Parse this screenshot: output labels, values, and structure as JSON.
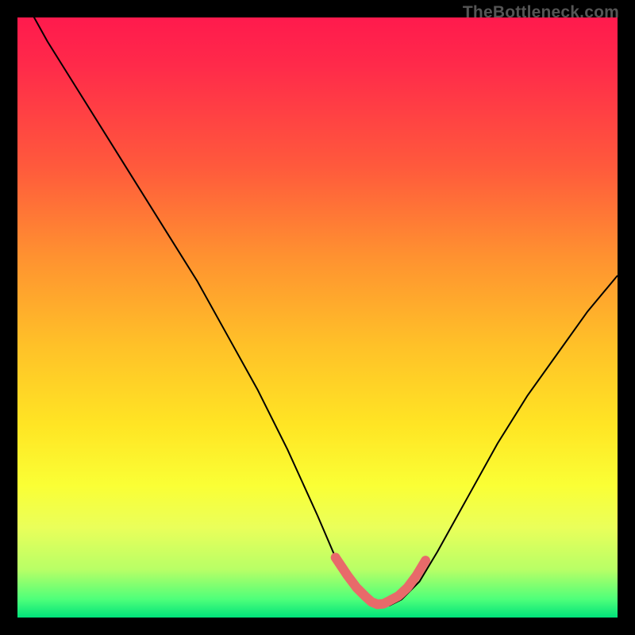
{
  "watermark": "TheBottleneck.com",
  "chart_data": {
    "type": "line",
    "title": "",
    "xlabel": "",
    "ylabel": "",
    "x_range": [
      0,
      100
    ],
    "y_range": [
      0,
      100
    ],
    "series": [
      {
        "name": "bottleneck-curve",
        "color": "#000000",
        "x": [
          0,
          5,
          10,
          15,
          20,
          25,
          30,
          35,
          40,
          45,
          50,
          53,
          56,
          58,
          60,
          62,
          64,
          67,
          70,
          75,
          80,
          85,
          90,
          95,
          100
        ],
        "y": [
          105,
          96,
          88,
          80,
          72,
          64,
          56,
          47,
          38,
          28,
          17,
          10,
          5,
          3,
          2,
          2,
          3,
          6,
          11,
          20,
          29,
          37,
          44,
          51,
          57
        ]
      },
      {
        "name": "valley-highlight",
        "color": "#e86a6a",
        "thick": true,
        "x": [
          53,
          55,
          56.5,
          58,
          59,
          60,
          61,
          62,
          63.5,
          65,
          66.5,
          68
        ],
        "y": [
          10,
          7,
          5,
          3.5,
          2.6,
          2.2,
          2.3,
          2.8,
          3.6,
          5,
          7,
          9.5
        ]
      }
    ],
    "gradient_stops": [
      {
        "pos": 0.0,
        "color": "#ff1a4d"
      },
      {
        "pos": 0.08,
        "color": "#ff2a4a"
      },
      {
        "pos": 0.25,
        "color": "#ff5a3c"
      },
      {
        "pos": 0.4,
        "color": "#ff9230"
      },
      {
        "pos": 0.55,
        "color": "#ffc228"
      },
      {
        "pos": 0.68,
        "color": "#ffe524"
      },
      {
        "pos": 0.78,
        "color": "#faff35"
      },
      {
        "pos": 0.85,
        "color": "#eaff5a"
      },
      {
        "pos": 0.92,
        "color": "#b8ff66"
      },
      {
        "pos": 0.97,
        "color": "#4dff7a"
      },
      {
        "pos": 1.0,
        "color": "#00e27a"
      }
    ]
  }
}
